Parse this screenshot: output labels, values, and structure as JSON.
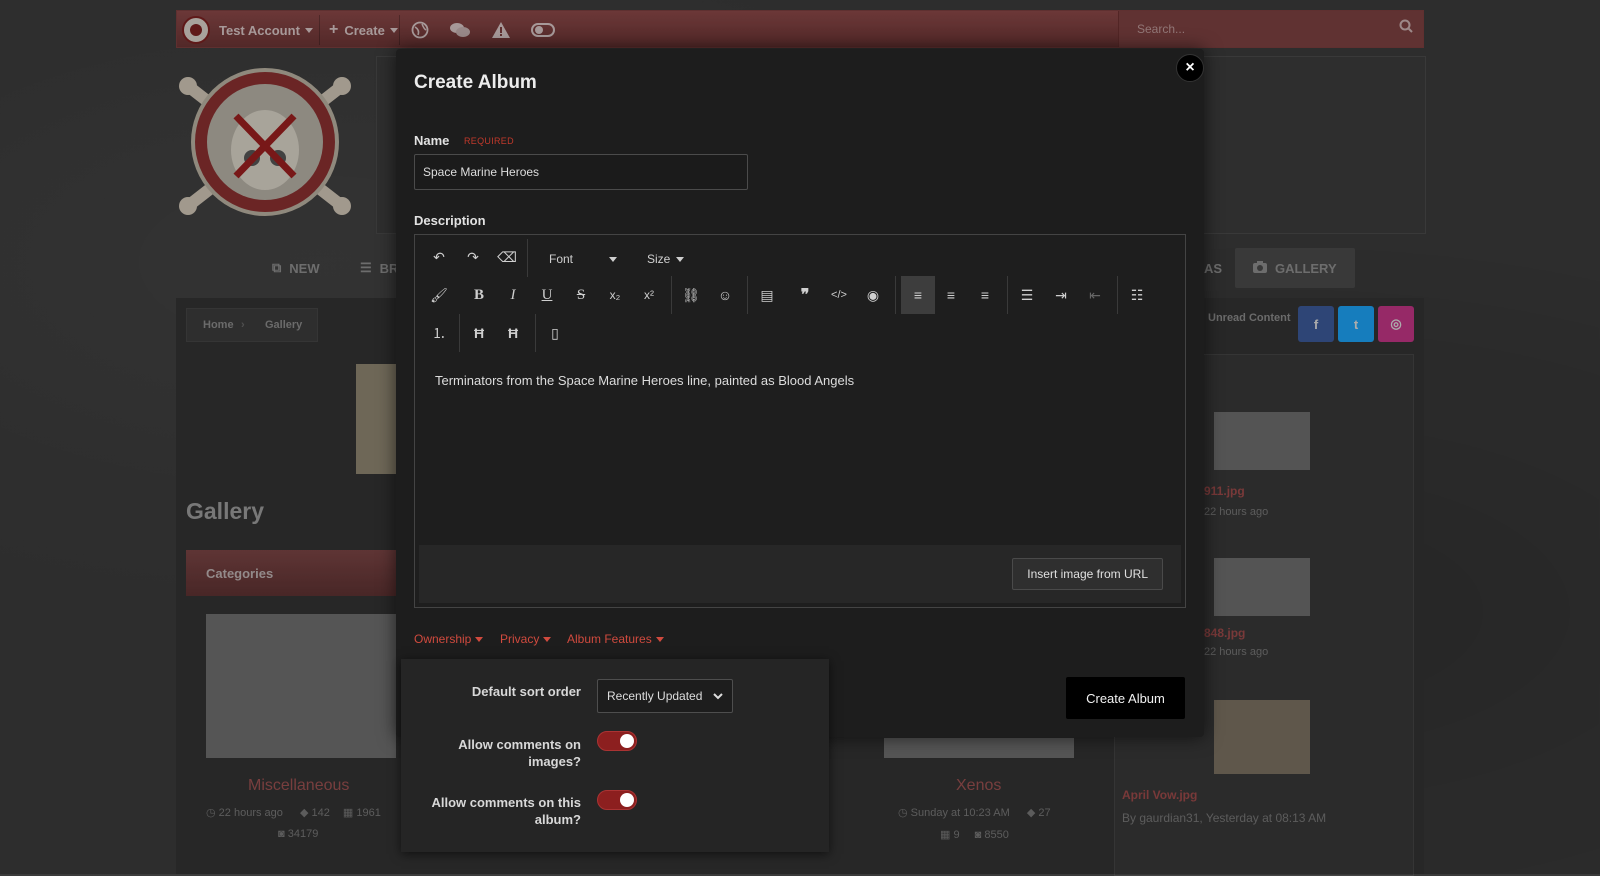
{
  "topbar": {
    "account_label": "Test Account",
    "create_label": "Create",
    "search_placeholder": "Search..."
  },
  "nav": {
    "new_label": "NEW",
    "browse_label": "BR",
    "ideas_label": "AS",
    "gallery_label": "GALLERY"
  },
  "breadcrumb": {
    "home": "Home",
    "gallery": "Gallery"
  },
  "unread_label": "Unread Content",
  "page_title": "Gallery",
  "categories_label": "Categories",
  "cards": [
    {
      "title": "Miscellaneous",
      "time": "22 hours ago",
      "comments": "142",
      "albums": "1961",
      "images": "34179"
    },
    {
      "title": "Xenos",
      "time": "Sunday at 10:23 AM",
      "comments": "27",
      "albums": "9",
      "images": "8550"
    }
  ],
  "sidebar_items": [
    {
      "name": "911.jpg",
      "meta": "22 hours ago"
    },
    {
      "name": "848.jpg",
      "meta": "22 hours ago"
    },
    {
      "name": "April Vow.jpg",
      "meta": "By gaurdian31, Yesterday at 08:13 AM"
    }
  ],
  "modal": {
    "title": "Create Album",
    "name_label": "Name",
    "required_label": "REQUIRED",
    "name_value": "Space Marine Heroes",
    "description_label": "Description",
    "font_label": "Font",
    "size_label": "Size",
    "description_text": "Terminators from the Space Marine Heroes line, painted as Blood Angels",
    "insert_image_label": "Insert image from URL",
    "tabs": [
      "Ownership",
      "Privacy",
      "Album Features"
    ],
    "submit_label": "Create Album"
  },
  "album_features": {
    "sort_label": "Default sort order",
    "sort_value": "Recently Updated",
    "allow_image_comments_label": "Allow comments on images?",
    "allow_image_comments": true,
    "allow_album_comments_label": "Allow comments on this album?",
    "allow_album_comments": true
  },
  "colors": {
    "accent": "#d04a3e",
    "toggle_on": "#8c1f1f",
    "modal_bg": "#1d1d1d",
    "topbar": "#7a3e3e"
  }
}
